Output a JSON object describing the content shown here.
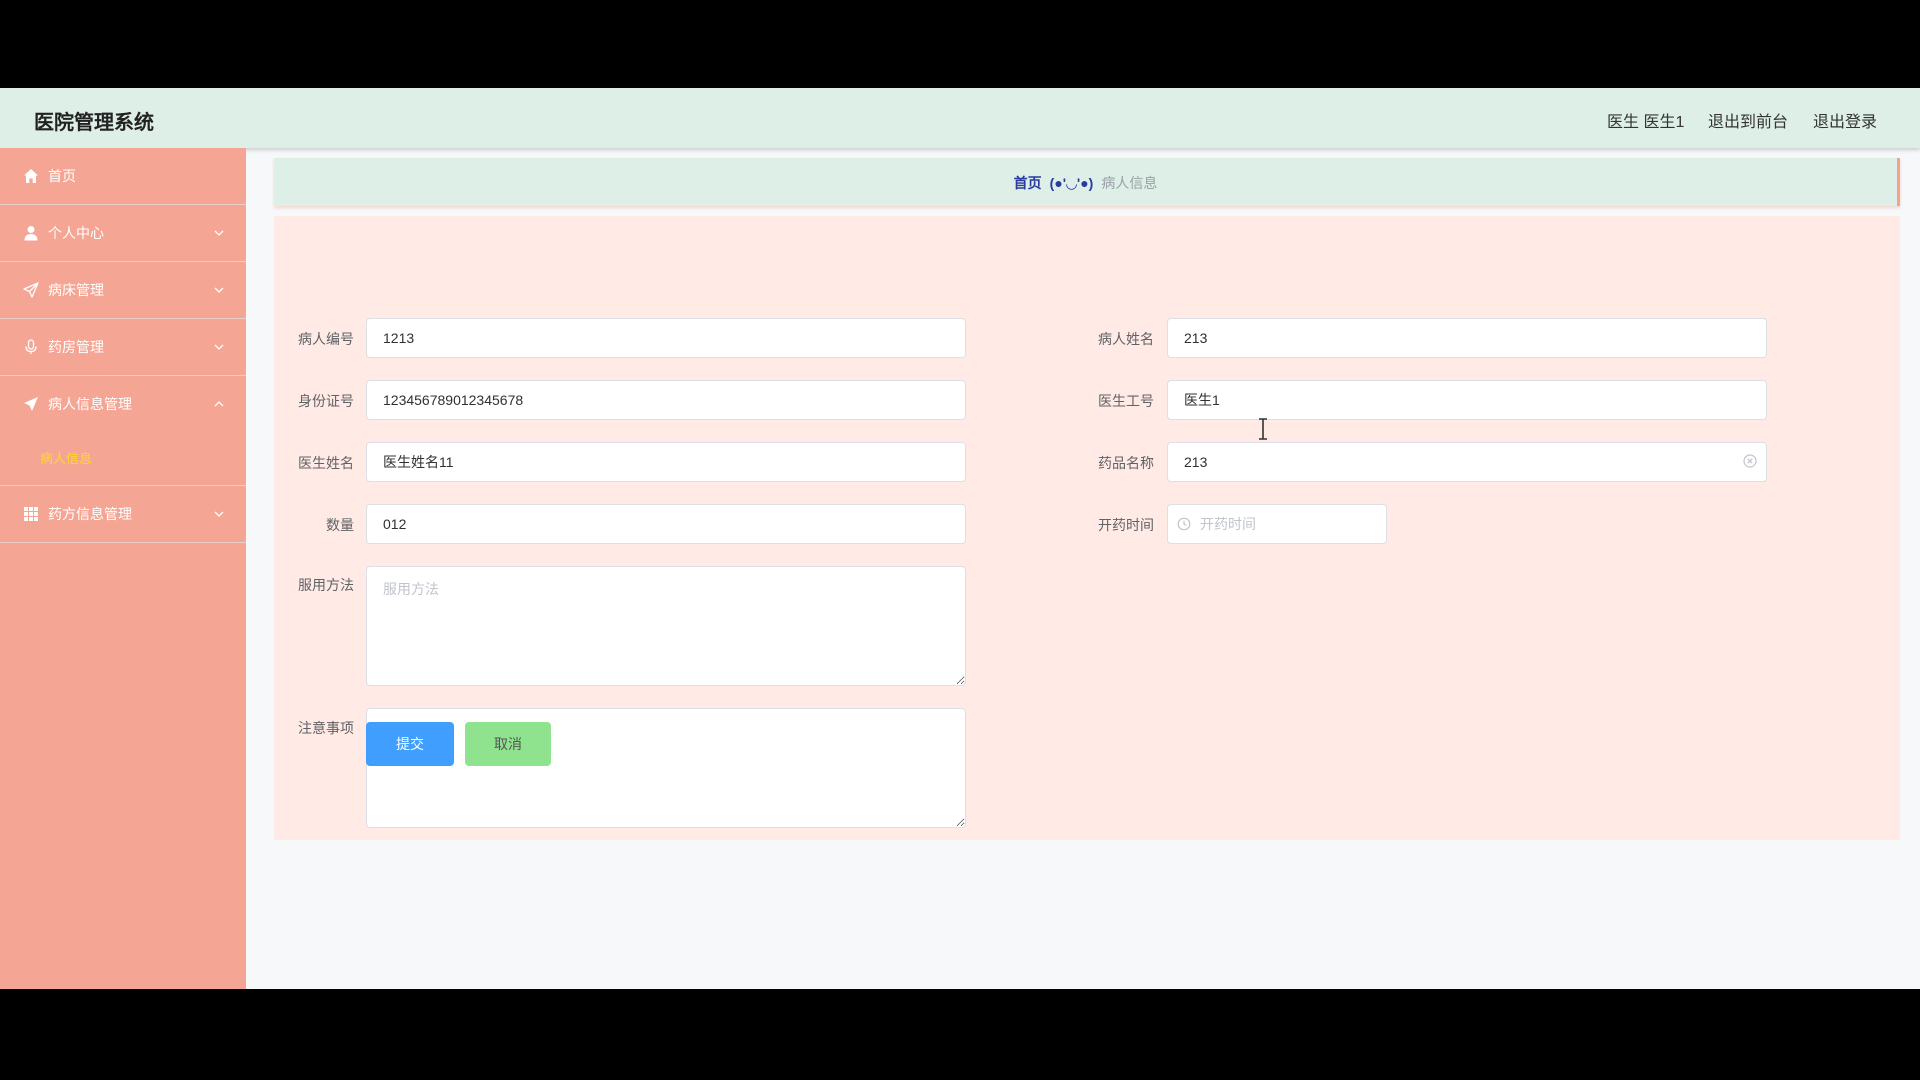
{
  "header": {
    "app_title": "医院管理系统",
    "user_label": "医生 医生1",
    "exit_front_label": "退出到前台",
    "logout_label": "退出登录"
  },
  "sidebar": {
    "items": [
      {
        "label": "首页",
        "icon": "home-icon",
        "expanded": false
      },
      {
        "label": "个人中心",
        "icon": "user-icon",
        "expanded": false
      },
      {
        "label": "病床管理",
        "icon": "paper-plane-outline-icon",
        "expanded": false
      },
      {
        "label": "药房管理",
        "icon": "microphone-icon",
        "expanded": false
      },
      {
        "label": "病人信息管理",
        "icon": "paper-plane-icon",
        "expanded": true
      },
      {
        "label": "药方信息管理",
        "icon": "grid-icon",
        "expanded": false
      }
    ],
    "submenu_active": "病人信息"
  },
  "breadcrumb": {
    "home": "首页",
    "separator": "(●'◡'●)",
    "current": "病人信息"
  },
  "form": {
    "patient_id": {
      "label": "病人编号",
      "value": "1213"
    },
    "patient_name": {
      "label": "病人姓名",
      "value": "213"
    },
    "id_card": {
      "label": "身份证号",
      "value": "123456789012345678"
    },
    "doctor_id": {
      "label": "医生工号",
      "value": "医生1"
    },
    "doctor_name": {
      "label": "医生姓名",
      "value": "医生姓名11"
    },
    "drug_name": {
      "label": "药品名称",
      "value": "213"
    },
    "quantity": {
      "label": "数量",
      "value": "012"
    },
    "prescribe_time": {
      "label": "开药时间",
      "placeholder": "开药时间"
    },
    "usage": {
      "label": "服用方法",
      "placeholder": "服用方法"
    },
    "notes": {
      "label": "注意事项",
      "placeholder": "注意事项"
    },
    "submit_label": "提交",
    "cancel_label": "取消"
  },
  "colors": {
    "topbar": "#deefe7",
    "sidebar": "#f5a593",
    "panel": "#ffeae6",
    "primary": "#409eff",
    "cancel": "#8fe38f",
    "active_submenu": "#ffd631"
  }
}
